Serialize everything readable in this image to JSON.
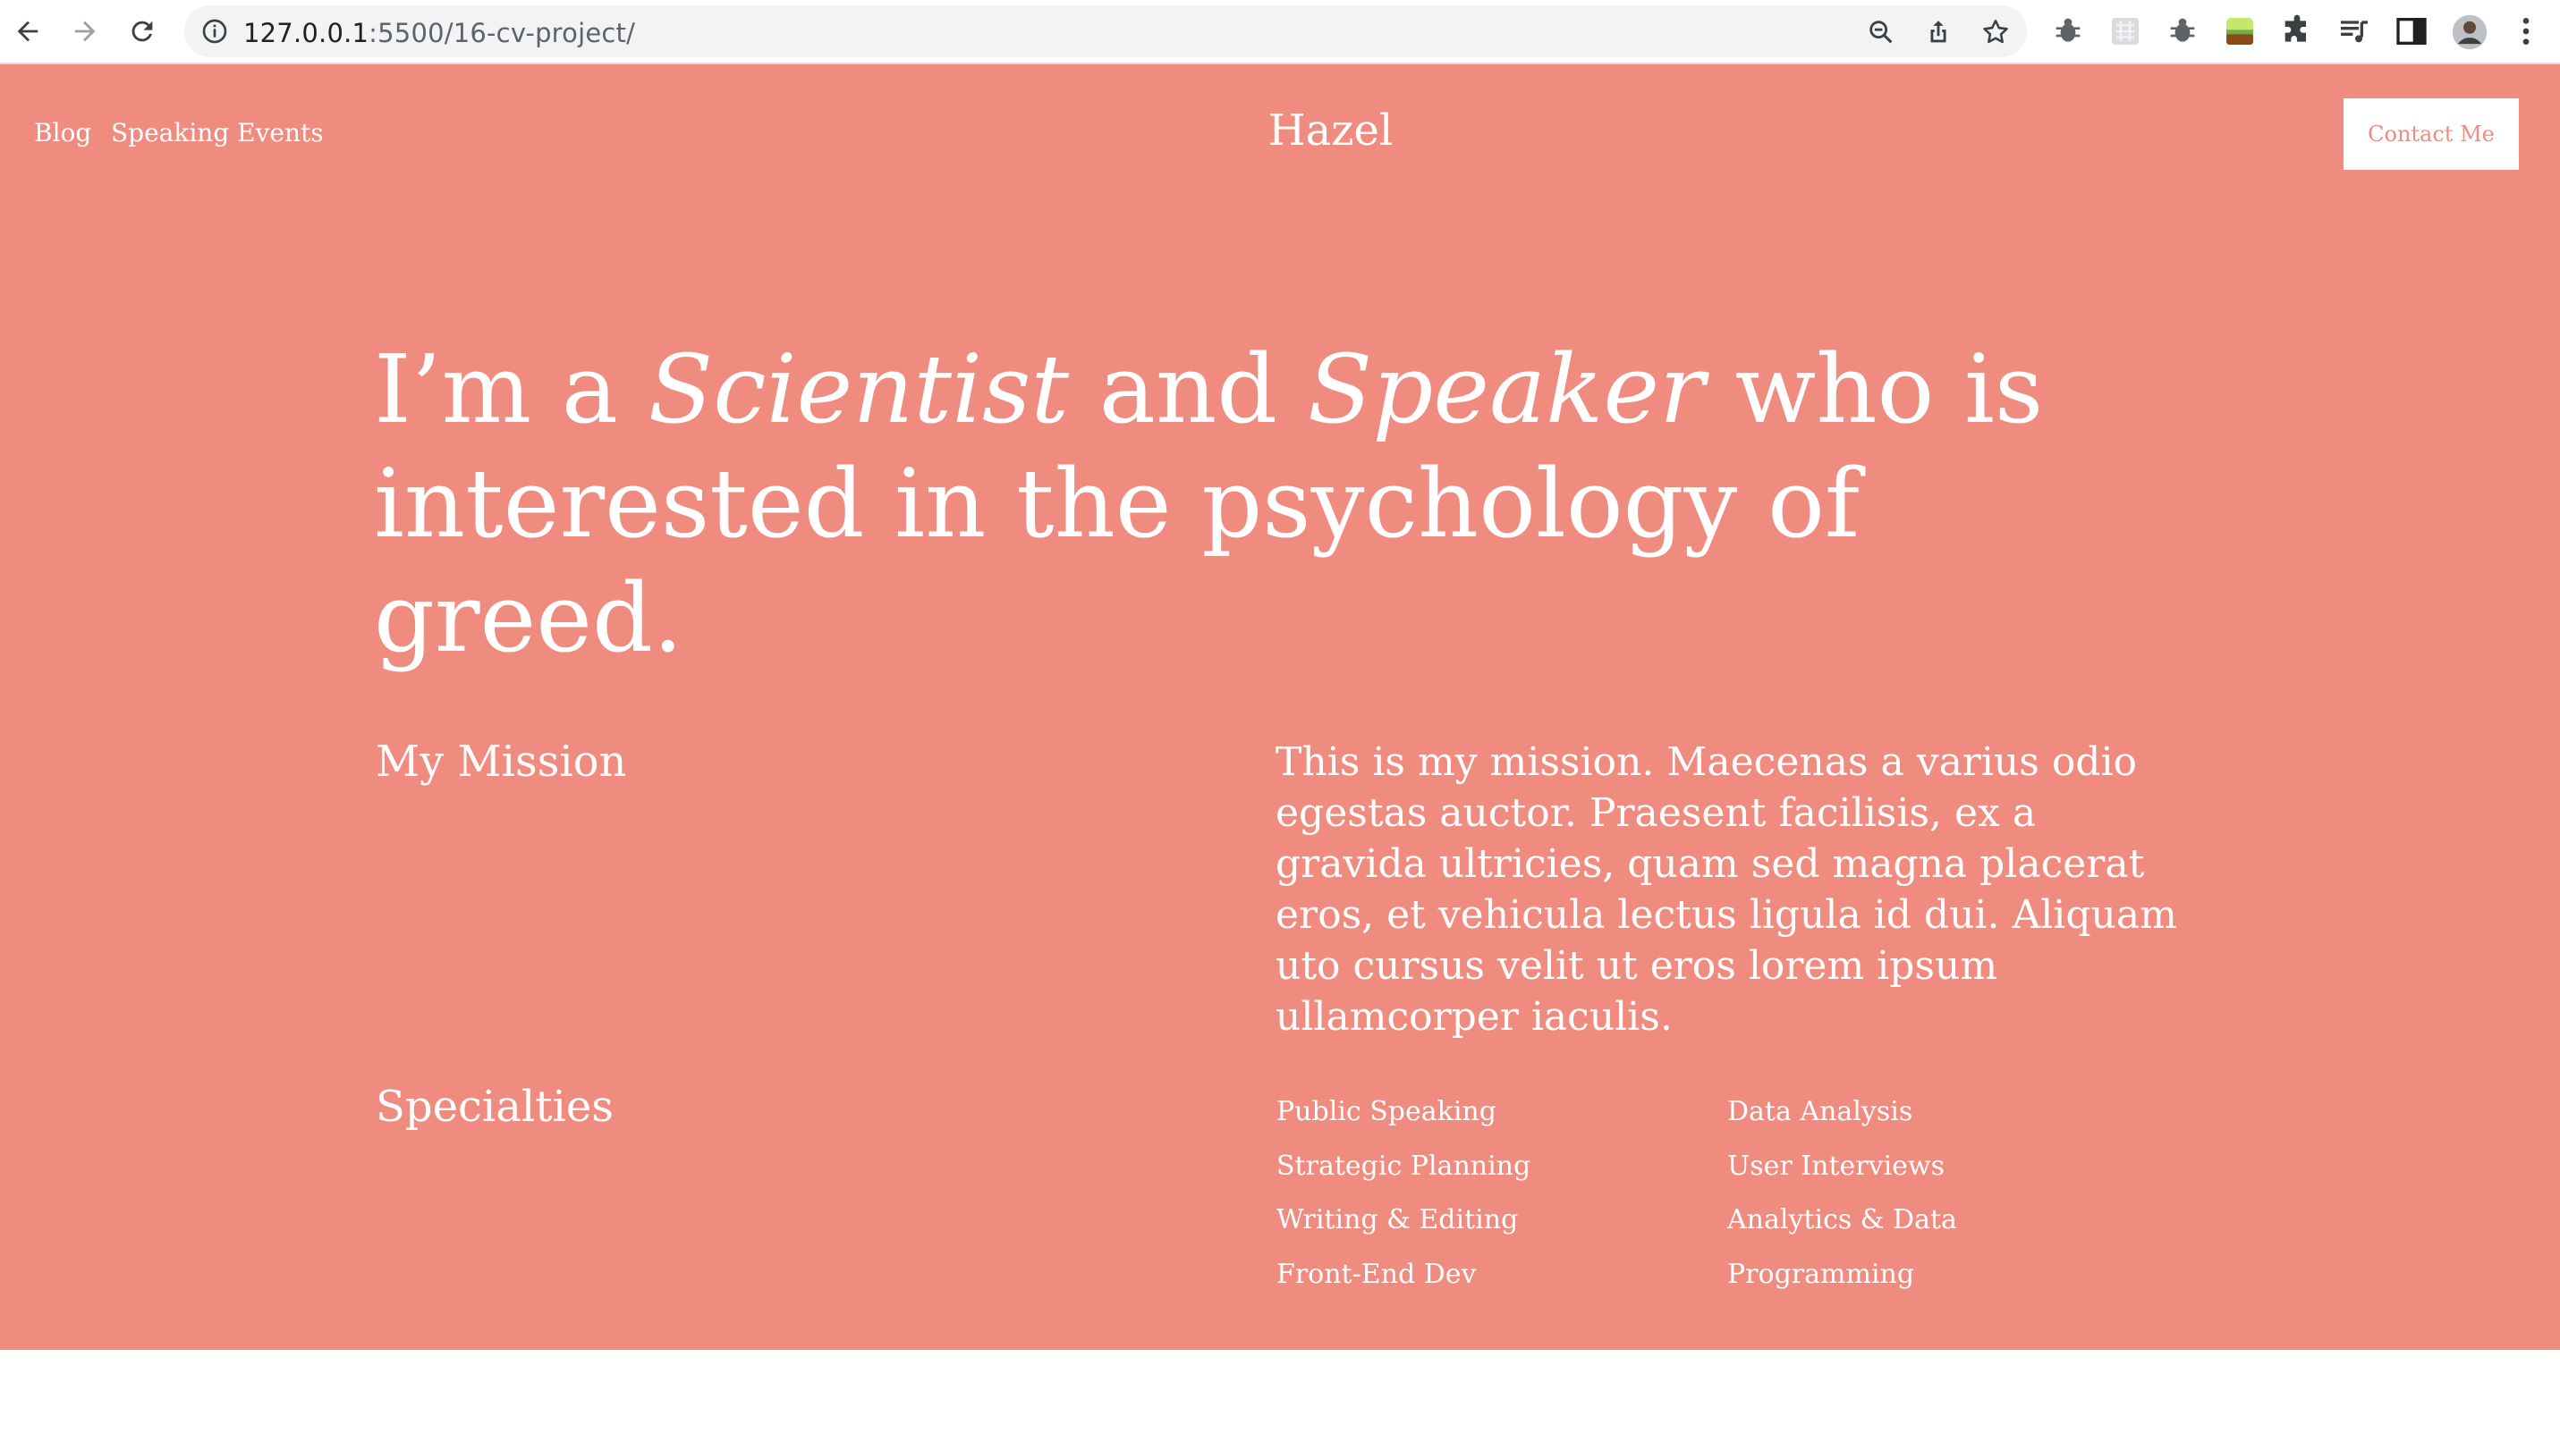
{
  "browser": {
    "url_host": "127.0.0.1",
    "url_path": ":5500/16-cv-project/",
    "icons": [
      "back-arrow-icon",
      "forward-arrow-icon",
      "reload-icon",
      "info-icon",
      "zoom-icon",
      "share-icon",
      "bookmark-star-icon",
      "bug-extension-icon",
      "grid-extension-icon",
      "bug-extension-icon",
      "landscape-extension-icon",
      "puzzle-extensions-icon",
      "media-queue-icon",
      "side-panel-icon",
      "profile-avatar-icon",
      "more-menu-icon"
    ]
  },
  "nav": {
    "links": [
      "Blog",
      "Speaking Events"
    ],
    "brand": "Hazel",
    "contact_label": "Contact Me"
  },
  "hero": {
    "prefix": "I’m a ",
    "role1": "Scientist",
    "mid": " and ",
    "role2": "Speaker",
    "suffix": " who is interested in the psychology of greed."
  },
  "mission": {
    "title": "My Mission",
    "text": "This is my mission. Maecenas a varius odio egestas auctor. Praesent facilisis, ex a gravida ultricies, quam sed magna placerat eros, et vehicula lectus ligula id dui. Aliquam uto cursus velit ut eros lorem ipsum ullamcorper iaculis."
  },
  "specialties": {
    "title": "Specialties",
    "col1": [
      "Public Speaking",
      "Strategic Planning",
      "Writing & Editing",
      "Front-End Dev"
    ],
    "col2": [
      "Data Analysis",
      "User Interviews",
      "Analytics & Data",
      "Programming"
    ]
  },
  "colors": {
    "page_background": "#f08b80",
    "text": "#ffffff",
    "button_background": "#ffffff",
    "button_text": "#f08b80"
  }
}
